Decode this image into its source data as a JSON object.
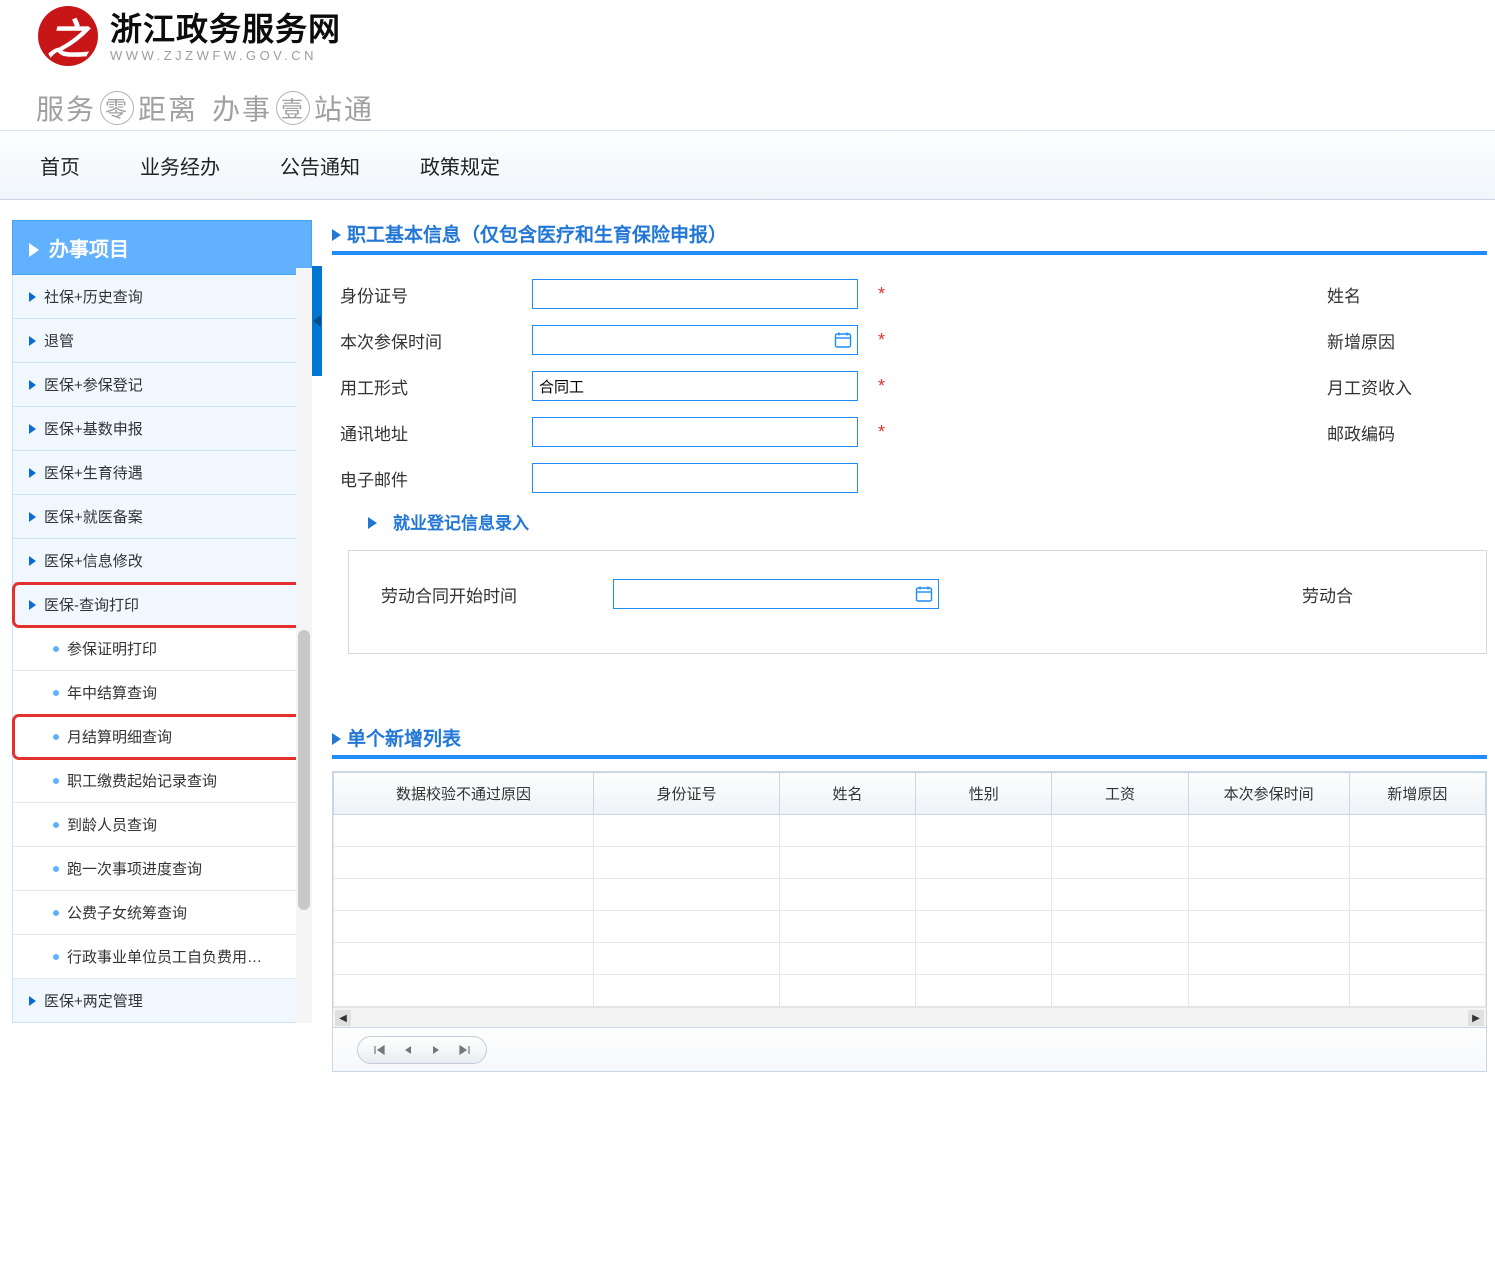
{
  "header": {
    "logo_letter": "之",
    "site_title": "浙江政务服务网",
    "site_url": "WWW.ZJZWFW.GOV.CN",
    "slogan_parts": [
      "服务",
      "零",
      "距离",
      "办事",
      "壹",
      "站通"
    ]
  },
  "nav": {
    "items": [
      "首页",
      "业务经办",
      "公告通知",
      "政策规定"
    ]
  },
  "sidebar": {
    "header": "办事项目",
    "items": [
      {
        "label": "社保+历史查询",
        "type": "main"
      },
      {
        "label": "退管",
        "type": "main"
      },
      {
        "label": "医保+参保登记",
        "type": "main"
      },
      {
        "label": "医保+基数申报",
        "type": "main"
      },
      {
        "label": "医保+生育待遇",
        "type": "main"
      },
      {
        "label": "医保+就医备案",
        "type": "main"
      },
      {
        "label": "医保+信息修改",
        "type": "main"
      },
      {
        "label": "医保-查询打印",
        "type": "main",
        "highlight": true
      },
      {
        "label": "参保证明打印",
        "type": "sub"
      },
      {
        "label": "年中结算查询",
        "type": "sub"
      },
      {
        "label": "月结算明细查询",
        "type": "sub",
        "highlight": true
      },
      {
        "label": "职工缴费起始记录查询",
        "type": "sub"
      },
      {
        "label": "到龄人员查询",
        "type": "sub"
      },
      {
        "label": "跑一次事项进度查询",
        "type": "sub"
      },
      {
        "label": "公费子女统筹查询",
        "type": "sub"
      },
      {
        "label": "行政事业单位员工自负费用…",
        "type": "sub"
      },
      {
        "label": "医保+两定管理",
        "type": "main"
      }
    ]
  },
  "form": {
    "section_title": "职工基本信息（仅包含医疗和生育保险申报）",
    "rows": {
      "r1": {
        "label": "身份证号",
        "value": "",
        "required": true,
        "label2": "姓名"
      },
      "r2": {
        "label": "本次参保时间",
        "value": "",
        "required": true,
        "label2": "新增原因",
        "icon": "calendar"
      },
      "r3": {
        "label": "用工形式",
        "value": "合同工",
        "required": true,
        "label2": "月工资收入"
      },
      "r4": {
        "label": "通讯地址",
        "value": "",
        "required": true,
        "label2": "邮政编码"
      },
      "r5": {
        "label": "电子邮件",
        "value": ""
      }
    },
    "sub_section": "就业登记信息录入",
    "boxed_row": {
      "label": "劳动合同开始时间",
      "value": "",
      "icon": "calendar",
      "label2": "劳动合"
    }
  },
  "table": {
    "section_title": "单个新增列表",
    "columns": [
      "数据校验不通过原因",
      "身份证号",
      "姓名",
      "性别",
      "工资",
      "本次参保时间",
      "新增原因"
    ],
    "empty_rows": 6
  }
}
